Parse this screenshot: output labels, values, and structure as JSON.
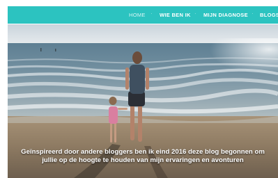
{
  "nav": {
    "items": [
      {
        "label": "HOME",
        "active": true
      },
      {
        "label": "WIE BEN IK",
        "active": false
      },
      {
        "label": "MIJN DIAGNOSE",
        "active": false
      },
      {
        "label": "BLOGS",
        "active": false
      }
    ],
    "separator": "·",
    "accent_color": "#2cc3c0"
  },
  "hero": {
    "caption_line1": "Geïnspireerd door andere bloggers ben ik eind 2016 deze blog begonnen om",
    "caption_line2": "jullie op de hoogte te houden van mijn ervaringen en avonturen"
  }
}
